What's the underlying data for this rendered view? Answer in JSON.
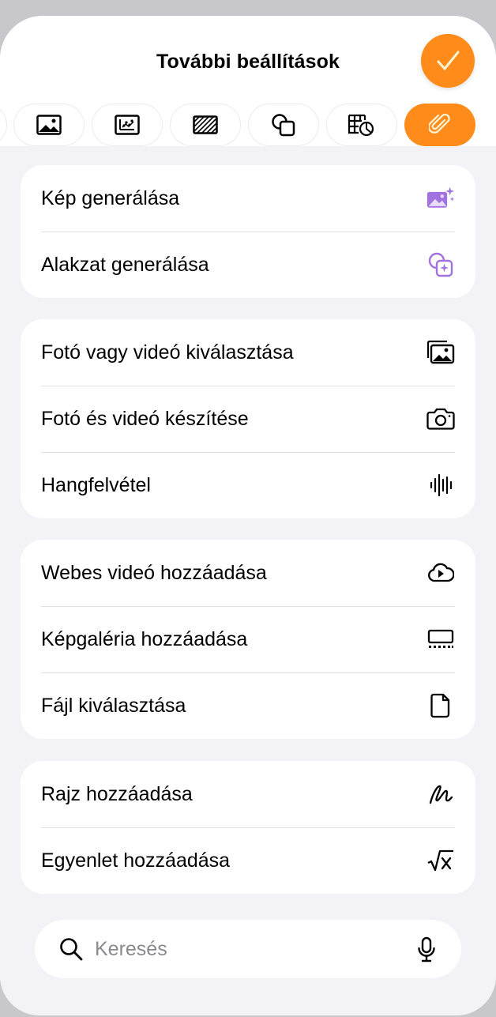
{
  "header": {
    "title": "További beállítások",
    "done_icon": "checkmark-icon"
  },
  "tabs": [
    {
      "icon": "photo-icon",
      "active": false
    },
    {
      "icon": "chart-icon",
      "active": false
    },
    {
      "icon": "texture-icon",
      "active": false
    },
    {
      "icon": "shapes-icon",
      "active": false
    },
    {
      "icon": "table-chart-icon",
      "active": false
    },
    {
      "icon": "paperclip-icon",
      "active": true
    }
  ],
  "sections": [
    {
      "items": [
        {
          "label": "Kép generálása",
          "icon": "image-sparkle-icon"
        },
        {
          "label": "Alakzat generálása",
          "icon": "shape-sparkle-icon"
        }
      ]
    },
    {
      "items": [
        {
          "label": "Fotó vagy videó kiválasztása",
          "icon": "photo-library-icon"
        },
        {
          "label": "Fotó és videó készítése",
          "icon": "camera-icon"
        },
        {
          "label": "Hangfelvétel",
          "icon": "waveform-icon"
        }
      ]
    },
    {
      "items": [
        {
          "label": "Webes videó hozzáadása",
          "icon": "cloud-play-icon"
        },
        {
          "label": "Képgaléria hozzáadása",
          "icon": "gallery-icon"
        },
        {
          "label": "Fájl kiválasztása",
          "icon": "document-icon"
        }
      ]
    },
    {
      "items": [
        {
          "label": "Rajz hozzáadása",
          "icon": "scribble-icon"
        },
        {
          "label": "Egyenlet hozzáadása",
          "icon": "square-root-icon"
        }
      ]
    }
  ],
  "search": {
    "placeholder": "Keresés",
    "icon": "search-icon",
    "mic_icon": "microphone-icon"
  },
  "colors": {
    "accent": "#ff8c1a",
    "ai_purple": "#a273e0",
    "background": "#f2f2f7"
  }
}
